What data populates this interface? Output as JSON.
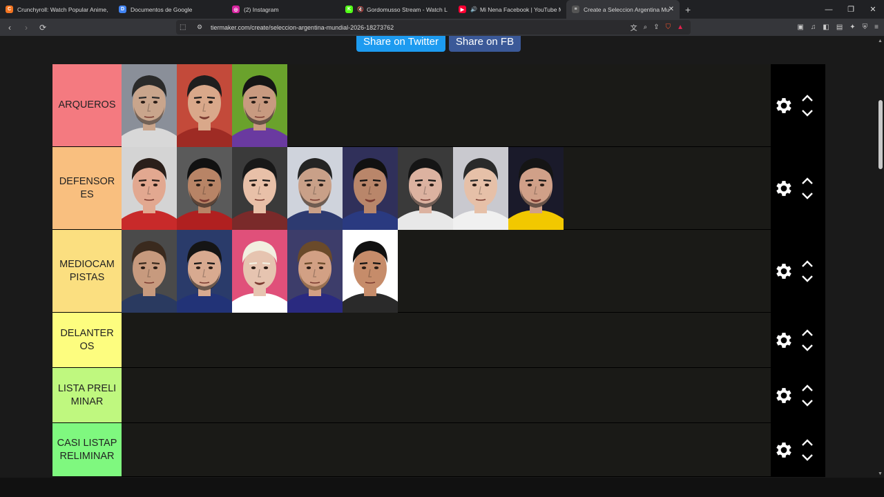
{
  "browser": {
    "tabs": [
      {
        "label": "Crunchyroll: Watch Popular Anime, P",
        "favicon_color": "#f47521",
        "glyph": "C"
      },
      {
        "label": "Documentos de Google",
        "favicon_color": "#4285f4",
        "glyph": "D"
      },
      {
        "label": "(2) Instagram",
        "favicon_color": "#d6249f",
        "glyph": "◎"
      },
      {
        "label": "Gordomusso Stream - Watch Live",
        "favicon_color": "#53fc18",
        "glyph": "K",
        "muted": true
      },
      {
        "label": "Mi Nena Facebook | YouTube Mu",
        "favicon_color": "#ff0033",
        "glyph": "▶",
        "sound": true
      },
      {
        "label": "Create a Seleccion Argentina Mu",
        "favicon_color": "#555555",
        "glyph": "≡",
        "active": true
      }
    ],
    "url": "tiermaker.com/create/seleccion-argentina-mundial-2026-18273762"
  },
  "share": {
    "twitter": "Share on Twitter",
    "facebook": "Share on FB"
  },
  "tiers": [
    {
      "label": "ARQUEROS",
      "color": "#f47a80",
      "height": 120,
      "cards": 3
    },
    {
      "label": "DEFENSORES",
      "color": "#f9bf7f",
      "height": 120,
      "cards": 8
    },
    {
      "label": "MEDIOCAMPISTAS",
      "color": "#fbdf80",
      "height": 120,
      "cards": 5
    },
    {
      "label": "DELANTEROS",
      "color": "#fdfd7f",
      "height": 80,
      "cards": 0
    },
    {
      "label": "LISTA PRELIMINAR",
      "color": "#bff87f",
      "height": 80,
      "cards": 0
    },
    {
      "label": "CASI LISTAPRELIMINAR",
      "color": "#7ff87f",
      "height": 78,
      "cards": 0
    }
  ],
  "card_palettes": [
    [
      "#8a8f99",
      "#c9a58c",
      "#2a2a2a",
      "#d8d8d8"
    ],
    [
      "#c34a3a",
      "#d9a88a",
      "#1e1e1e",
      "#9e2b24"
    ],
    [
      "#6aa22c",
      "#c89a80",
      "#151515",
      "#6a3aa0"
    ],
    [
      "#d4d4d4",
      "#e2a890",
      "#2a1f1a",
      "#c82a2a"
    ],
    [
      "#5a5a5a",
      "#b88466",
      "#111111",
      "#b02020"
    ],
    [
      "#3a3a3a",
      "#e8c0a8",
      "#181818",
      "#7a2a2a"
    ],
    [
      "#cfd3dc",
      "#c9a088",
      "#242424",
      "#2d3a70"
    ],
    [
      "#30305a",
      "#b9866a",
      "#111111",
      "#2a3a80"
    ],
    [
      "#3a3a3a",
      "#dcb2a0",
      "#151515",
      "#e8e8e8"
    ],
    [
      "#c9c9cf",
      "#e6c0a8",
      "#2a2a2a",
      "#f0f0f0"
    ],
    [
      "#1a1a2a",
      "#d0a088",
      "#151515",
      "#f2c800"
    ],
    [
      "#4a4a4a",
      "#c79a7e",
      "#3a2a1e",
      "#2a3a60"
    ],
    [
      "#2a3b6a",
      "#d8aa90",
      "#151515",
      "#223377"
    ],
    [
      "#e0507a",
      "#e6c4b0",
      "#f2efe0",
      "#ffffff"
    ],
    [
      "#3d3d6a",
      "#d2a084",
      "#6a4a2a",
      "#2a2a80"
    ],
    [
      "#ffffff",
      "#c68c6a",
      "#111111",
      "#2a2a2a"
    ]
  ]
}
